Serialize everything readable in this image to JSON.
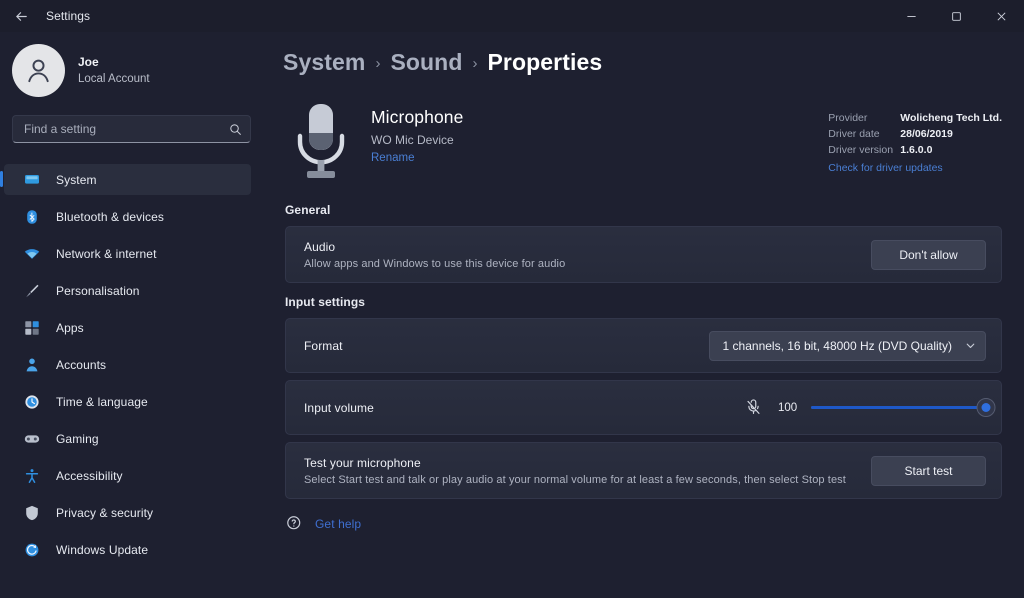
{
  "window": {
    "title": "Settings",
    "back_label": "Back",
    "controls": {
      "minimize": "Minimize",
      "maximize": "Maximize",
      "close": "Close"
    }
  },
  "sidebar": {
    "profile": {
      "name": "Joe",
      "account_type": "Local Account"
    },
    "search": {
      "placeholder": "Find a setting",
      "value": ""
    },
    "items": [
      {
        "label": "System",
        "icon": "display-icon",
        "active": true
      },
      {
        "label": "Bluetooth & devices",
        "icon": "bluetooth-icon",
        "active": false
      },
      {
        "label": "Network & internet",
        "icon": "wifi-icon",
        "active": false
      },
      {
        "label": "Personalisation",
        "icon": "brush-icon",
        "active": false
      },
      {
        "label": "Apps",
        "icon": "apps-icon",
        "active": false
      },
      {
        "label": "Accounts",
        "icon": "account-icon",
        "active": false
      },
      {
        "label": "Time & language",
        "icon": "clock-icon",
        "active": false
      },
      {
        "label": "Gaming",
        "icon": "gamepad-icon",
        "active": false
      },
      {
        "label": "Accessibility",
        "icon": "accessibility-icon",
        "active": false
      },
      {
        "label": "Privacy & security",
        "icon": "shield-icon",
        "active": false
      },
      {
        "label": "Windows Update",
        "icon": "update-icon",
        "active": false
      }
    ]
  },
  "breadcrumb": {
    "items": [
      "System",
      "Sound",
      "Properties"
    ],
    "separator": "›"
  },
  "device": {
    "icon": "microphone-icon",
    "name": "Microphone",
    "subtitle": "WO Mic Device",
    "rename_label": "Rename",
    "driver": {
      "provider_label": "Provider",
      "provider_value": "Wolicheng Tech Ltd.",
      "date_label": "Driver date",
      "date_value": "28/06/2019",
      "version_label": "Driver version",
      "version_value": "1.6.0.0",
      "update_link": "Check for driver updates"
    }
  },
  "general": {
    "heading": "General",
    "audio": {
      "title": "Audio",
      "description": "Allow apps and Windows to use this device for audio",
      "button_label": "Don't allow"
    }
  },
  "input_settings": {
    "heading": "Input settings",
    "format": {
      "label": "Format",
      "value": "1 channels, 16 bit, 48000 Hz (DVD Quality)",
      "chevron": "chevron-down-icon"
    },
    "volume": {
      "label": "Input volume",
      "mute_icon": "microphone-muted-icon",
      "value": "100",
      "percent": 100
    },
    "test": {
      "title": "Test your microphone",
      "description": "Select Start test and talk or play audio at your normal volume for at least a few seconds, then select Stop test",
      "button_label": "Start test"
    }
  },
  "footer": {
    "help_label": "Get help",
    "help_icon": "help-icon"
  },
  "colors": {
    "page_bg": "#1e2030",
    "titlebar_bg": "#1c1e2c",
    "card_bg": "#2a2e3f",
    "accent": "#2f7fe0",
    "link": "#4a7fd4",
    "slider_fill": "#1e58c8"
  }
}
